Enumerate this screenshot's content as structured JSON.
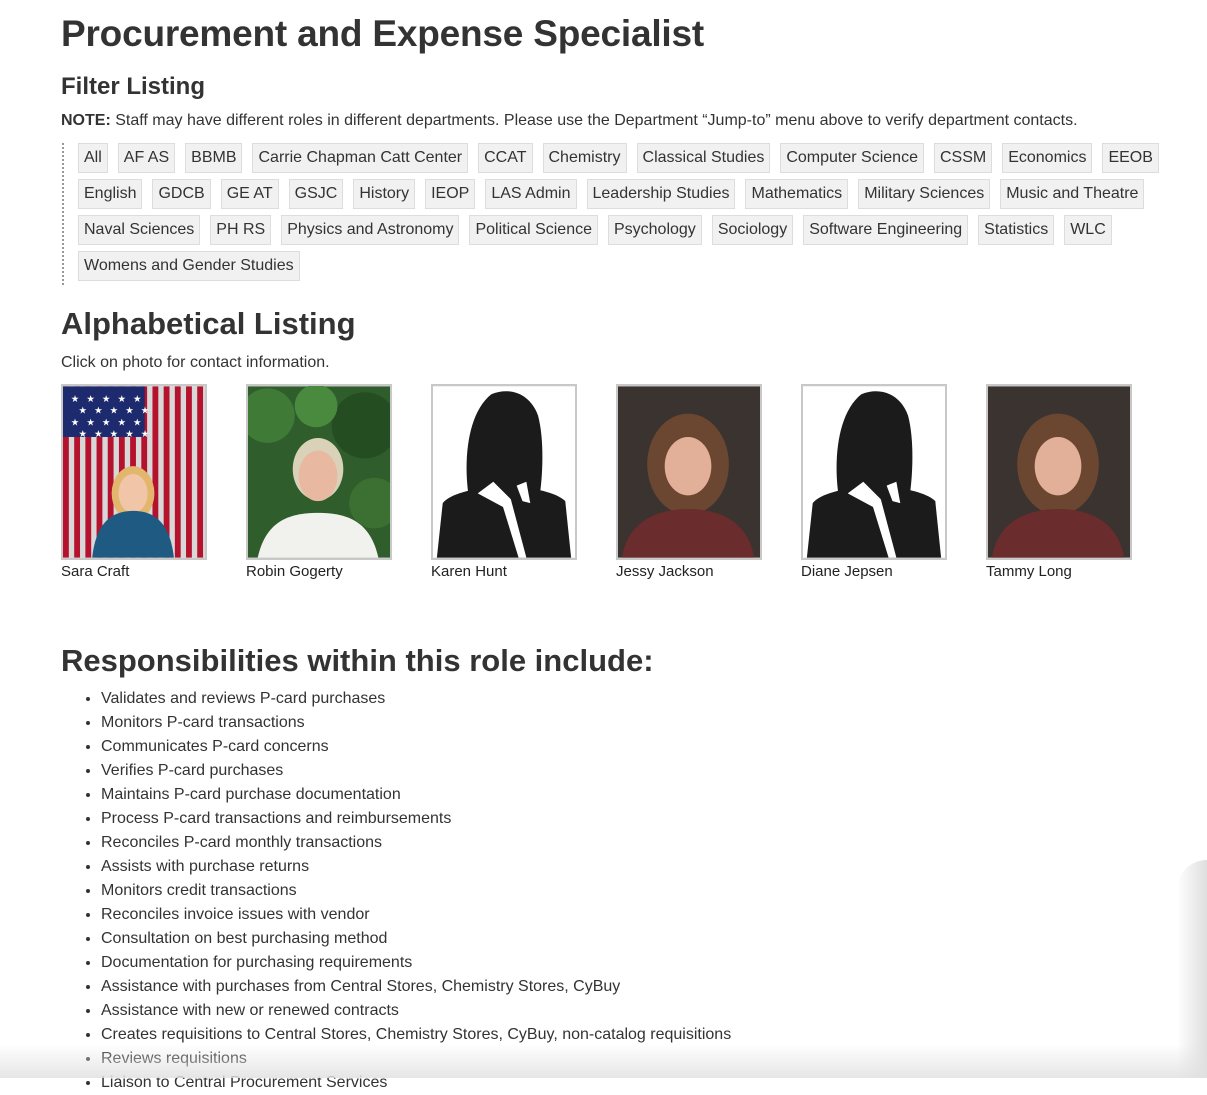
{
  "page": {
    "title": "Procurement and Expense Specialist"
  },
  "filter": {
    "heading": "Filter Listing",
    "note_label": "NOTE:",
    "note_text": " Staff may have different roles in different departments. Please use the Department “Jump-to” menu above to verify department contacts.",
    "departments": [
      "All",
      "AF AS",
      "BBMB",
      "Carrie Chapman Catt Center",
      "CCAT",
      "Chemistry",
      "Classical Studies",
      "Computer Science",
      "CSSM",
      "Economics",
      "EEOB",
      "English",
      "GDCB",
      "GE AT",
      "GSJC",
      "History",
      "IEOP",
      "LAS Admin",
      "Leadership Studies",
      "Mathematics",
      "Military Sciences",
      "Music and Theatre",
      "Naval Sciences",
      "PH RS",
      "Physics and Astronomy",
      "Political Science",
      "Psychology",
      "Sociology",
      "Software Engineering",
      "Statistics",
      "WLC",
      "Womens and Gender Studies"
    ]
  },
  "listing": {
    "heading": "Alphabetical Listing",
    "hint": "Click on photo for contact information.",
    "staff": [
      {
        "name": "Sara Craft",
        "photo": "flag-background-photo"
      },
      {
        "name": "Robin Gogerty",
        "photo": "greenery-background-photo"
      },
      {
        "name": "Karen Hunt",
        "photo": "placeholder-silhouette"
      },
      {
        "name": "Jessy Jackson",
        "photo": "dark-background-photo"
      },
      {
        "name": "Diane Jepsen",
        "photo": "placeholder-silhouette"
      },
      {
        "name": "Tammy Long",
        "photo": "dark-background-photo"
      }
    ]
  },
  "responsibilities": {
    "heading": "Responsibilities within this role include:",
    "items": [
      "Validates and reviews P-card purchases",
      "Monitors P-card transactions",
      "Communicates P-card concerns",
      "Verifies P-card purchases",
      "Maintains P-card purchase documentation",
      "Process P-card transactions and reimbursements",
      "Reconciles P-card monthly transactions",
      "Assists with purchase returns",
      "Monitors credit transactions",
      "Reconciles invoice issues with vendor",
      "Consultation on best purchasing method",
      "Documentation for purchasing requirements",
      "Assistance with purchases from Central Stores, Chemistry Stores, CyBuy",
      "Assistance with new or renewed contracts",
      "Creates requisitions to Central Stores, Chemistry Stores, CyBuy, non-catalog requisitions",
      "Reviews requisitions",
      "Liaison to Central Procurement Services"
    ]
  }
}
